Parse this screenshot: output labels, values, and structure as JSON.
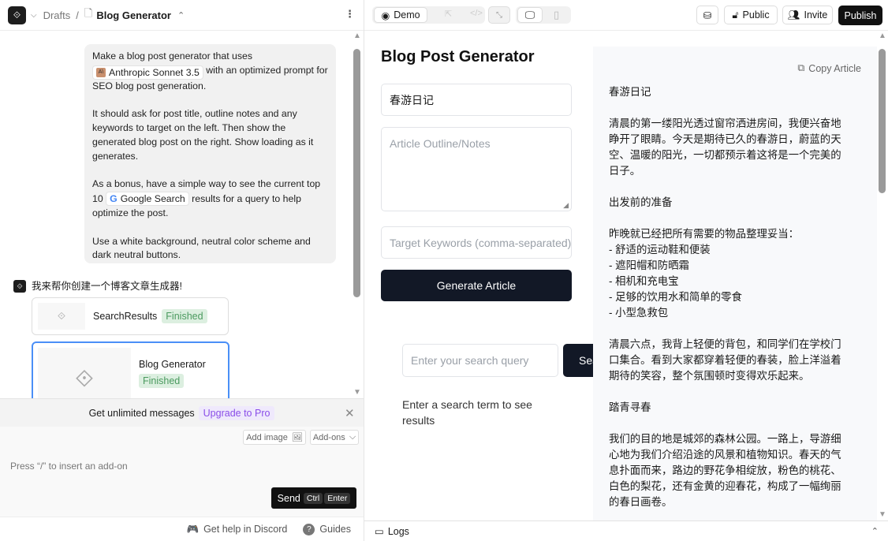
{
  "left": {
    "breadcrumb": {
      "root": "Drafts",
      "separator": "/",
      "current": "Blog Generator"
    },
    "prompt": {
      "p1_pre": "Make a blog post generator that uses",
      "model_chip": "Anthropic Sonnet 3.5",
      "p1_post": "with an optimized prompt for SEO blog post generation.",
      "p2": "It should ask for post title, outline notes and any keywords to target on the left. Then show the generated blog post on the right. Show loading as it generates.",
      "p3_pre": "As a bonus, have a simple way to see the current top 10",
      "search_chip": "Google Search",
      "p3_post": "results for a query to help optimize the post.",
      "p4": "Use a white background, neutral color scheme and dark neutral buttons."
    },
    "reply": "我来帮你创建一个博客文章生成器!",
    "cards": [
      {
        "title": "SearchResults",
        "status": "Finished"
      },
      {
        "title": "Blog Generator",
        "status": "Finished"
      }
    ],
    "upgrade": {
      "text": "Get unlimited messages",
      "link": "Upgrade to Pro"
    },
    "composer": {
      "add_image": "Add image",
      "addons": "Add-ons",
      "placeholder": "Press “/” to insert an add-on",
      "send": "Send",
      "kbd1": "Ctrl",
      "kbd2": "Enter"
    },
    "footer": {
      "discord": "Get help in Discord",
      "guides": "Guides"
    }
  },
  "toolbar": {
    "demo": "Demo",
    "public": "Public",
    "invite": "Invite",
    "publish": "Publish"
  },
  "app": {
    "title": "Blog Post Generator",
    "title_value": "春游日记",
    "outline_placeholder": "Article Outline/Notes",
    "keywords_placeholder": "Target Keywords (comma-separated)",
    "generate": "Generate Article",
    "search_placeholder": "Enter your search query",
    "search_button": "Search",
    "search_hint": "Enter a search term to see results",
    "copy": "Copy Article",
    "article": [
      "春游日记",
      "清晨的第一缕阳光透过窗帘洒进房间，我便兴奋地睁开了眼睛。今天是期待已久的春游日，蔚蓝的天空、温暖的阳光，一切都预示着这将是一个完美的日子。",
      "出发前的准备",
      "昨晚就已经把所有需要的物品整理妥当：\n- 舒适的运动鞋和便装\n- 遮阳帽和防晒霜\n- 相机和充电宝\n- 足够的饮用水和简单的零食\n- 小型急救包",
      "清晨六点，我背上轻便的背包，和同学们在学校门口集合。看到大家都穿着轻便的春装，脸上洋溢着期待的笑容，整个氛围顿时变得欢乐起来。",
      "踏青寻春",
      "我们的目的地是城郊的森林公园。一路上，导游细心地为我们介绍沿途的风景和植物知识。春天的气息扑面而来，路边的野花争相绽放，粉色的桃花、白色的梨花，还有金黄的迎春花，构成了一幅绚丽的春日画卷。"
    ]
  },
  "logs": "Logs"
}
